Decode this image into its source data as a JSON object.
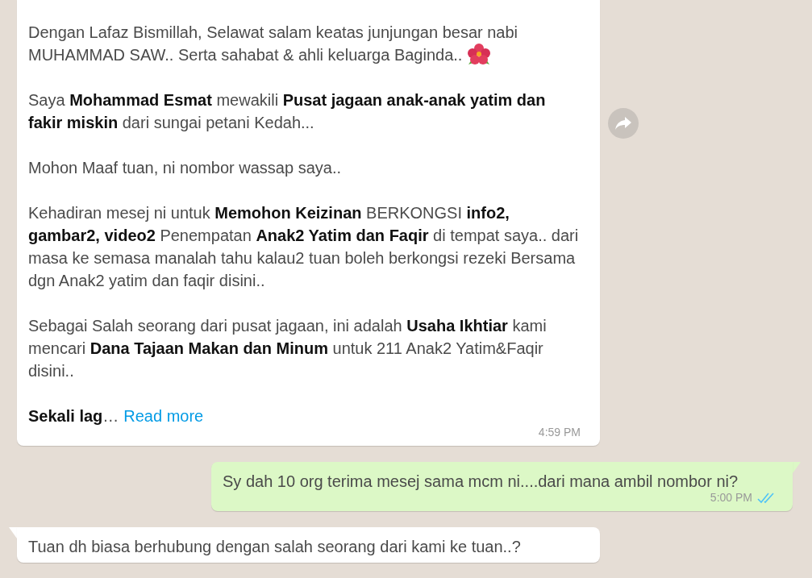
{
  "messages": [
    {
      "kind": "incoming",
      "paragraphs": [
        {
          "text": "Dengan Lafaz Bismillah, Selawat salam keatas junjungan besar nabi MUHAMMAD SAW.. Serta sahabat & ahli keluarga Baginda..",
          "kind": "decorated"
        },
        {
          "text": "Saya **Mohammad Esmat** mewakili **Pusat jagaan anak-anak yatim dan fakir miskin** dari sungai petani Kedah..."
        },
        {
          "text": "Mohon Maaf tuan, ni nombor wassap saya.."
        },
        {
          "text": "Kehadiran mesej ni untuk **Memohon Keizinan** BERKONGSI **info2, gambar2, video2** Penempatan **Anak2 Yatim dan Faqir** di tempat saya.. dari masa ke semasa manalah tahu kalau2 tuan boleh berkongsi rezeki Bersama dgn Anak2 yatim dan faqir disini.."
        },
        {
          "text": "Sebagai Salah seorang dari pusat jagaan, ini adalah **Usaha Ikhtiar** kami mencari **Dana Tajaan Makan dan Minum** untuk 211 Anak2 Yatim&Faqir disini.."
        }
      ],
      "read_more": {
        "lead": "**Sekali lag**…",
        "link": "Read more"
      },
      "time": "4:59 PM",
      "forward_button": true
    },
    {
      "kind": "outgoing",
      "text": "Sy dah 10 org terima mesej sama mcm ni....dari mana ambil nombor ni?",
      "time": "5:00 PM",
      "read": true
    },
    {
      "kind": "incoming",
      "text": "Tuan dh biasa berhubung dengan salah seorang dari kami ke tuan..?"
    }
  ]
}
